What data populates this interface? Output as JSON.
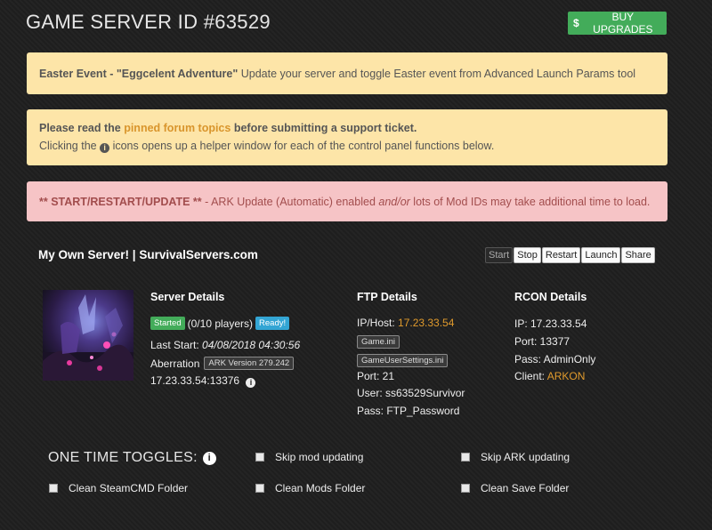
{
  "header": {
    "title": "GAME SERVER ID #63529",
    "buy_icon": "$",
    "buy_label": "BUY UPGRADES"
  },
  "alerts": {
    "easter": {
      "title": "Easter Event - \"Eggcelent Adventure\"",
      "text": " Update your server and toggle Easter event from Advanced Launch Params tool"
    },
    "support": {
      "prefix": "Please read the ",
      "link": "pinned forum topics",
      "suffix": " before submitting a support ticket.",
      "line2_prefix": "Clicking the ",
      "line2_suffix": " icons opens up a helper window for each of the control panel functions below."
    },
    "update": {
      "title": "** START/RESTART/UPDATE **",
      "text1": " - ARK Update (Automatic) enabled ",
      "em": "and/or",
      "text2": " lots of Mod IDs may take additional time to load."
    }
  },
  "server": {
    "name": "My Own Server! | SurvivalServers.com",
    "controls": [
      "Start",
      "Stop",
      "Restart",
      "Launch",
      "Share"
    ],
    "details": {
      "heading": "Server Details",
      "status": "Started",
      "players": "(0/10 players)",
      "ready": "Ready!",
      "last_start_label": "Last Start: ",
      "last_start": "04/08/2018 04:30:56",
      "map": "Aberration",
      "version": "ARK Version 279.242",
      "address": "17.23.33.54:13376"
    },
    "ftp": {
      "heading": "FTP Details",
      "host_label": "IP/Host: ",
      "host": "17.23.33.54",
      "file1": "Game.ini",
      "file2": "GameUserSettings.ini",
      "port": "Port: 21",
      "user": "User: ss63529Survivor",
      "pass": "Pass: FTP_Password"
    },
    "rcon": {
      "heading": "RCON Details",
      "ip": "IP: 17.23.33.54",
      "port": "Port: 13377",
      "pass": "Pass: AdminOnly",
      "client_label": "Client: ",
      "client": "ARKON"
    }
  },
  "toggles": {
    "title": "ONE TIME TOGGLES:",
    "items": [
      "Skip mod updating",
      "Skip ARK updating",
      "Clean SteamCMD Folder",
      "Clean Mods Folder",
      "Clean Save Folder"
    ]
  },
  "colors": {
    "green": "#43ac5a",
    "blue": "#33a5d4",
    "orange": "#e09a2c",
    "yellow_alert": "#fde5a8",
    "red_alert": "#f6c4c6"
  },
  "icons": {
    "info": "info-circle-icon",
    "dollar": "dollar-icon"
  }
}
